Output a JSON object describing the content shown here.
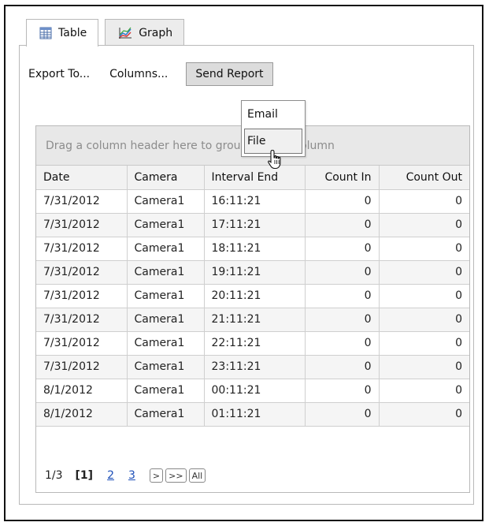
{
  "tabs": [
    {
      "label": "Table",
      "icon": "table-icon",
      "active": true
    },
    {
      "label": "Graph",
      "icon": "graph-icon",
      "active": false
    }
  ],
  "toolbar": {
    "export_label": "Export To...",
    "columns_label": "Columns...",
    "send_report_label": "Send Report"
  },
  "dropdown": {
    "items": [
      {
        "label": "Email"
      },
      {
        "label": "File"
      }
    ]
  },
  "grid": {
    "group_prompt": "Drag a column header here to group by that column",
    "columns": [
      "Date",
      "Camera",
      "Interval End",
      "Count In",
      "Count Out"
    ],
    "rows": [
      [
        "7/31/2012",
        "Camera1",
        "16:11:21",
        "0",
        "0"
      ],
      [
        "7/31/2012",
        "Camera1",
        "17:11:21",
        "0",
        "0"
      ],
      [
        "7/31/2012",
        "Camera1",
        "18:11:21",
        "0",
        "0"
      ],
      [
        "7/31/2012",
        "Camera1",
        "19:11:21",
        "0",
        "0"
      ],
      [
        "7/31/2012",
        "Camera1",
        "20:11:21",
        "0",
        "0"
      ],
      [
        "7/31/2012",
        "Camera1",
        "21:11:21",
        "0",
        "0"
      ],
      [
        "7/31/2012",
        "Camera1",
        "22:11:21",
        "0",
        "0"
      ],
      [
        "7/31/2012",
        "Camera1",
        "23:11:21",
        "0",
        "0"
      ],
      [
        "8/1/2012",
        "Camera1",
        "00:11:21",
        "0",
        "0"
      ],
      [
        "8/1/2012",
        "Camera1",
        "01:11:21",
        "0",
        "0"
      ]
    ]
  },
  "pager": {
    "position": "1/3",
    "current": "[1]",
    "pages": [
      "2",
      "3"
    ],
    "next": ">",
    "last": ">>",
    "all": "All"
  }
}
